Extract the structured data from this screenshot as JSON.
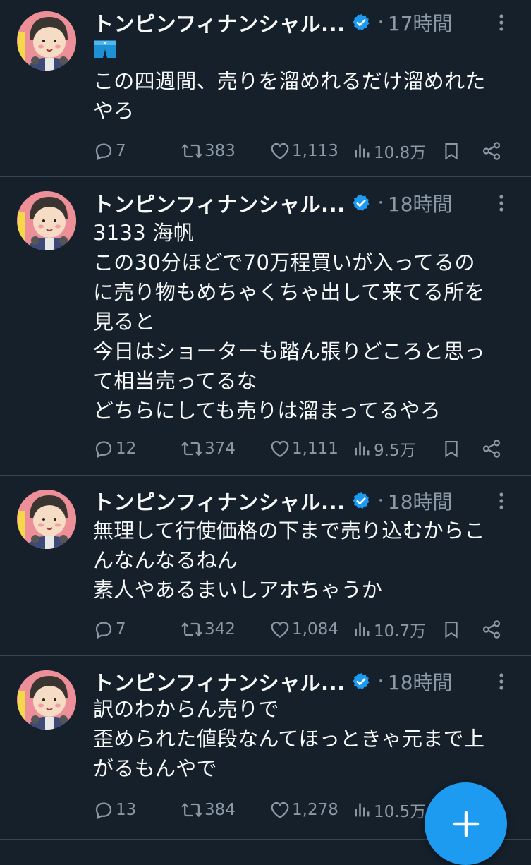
{
  "tweets": [
    {
      "name": "トンピンフィナンシャル...",
      "time": "17時間",
      "emoji": "🩳",
      "lines": [
        "この四週間、売りを溜めれるだけ溜めれた",
        "やろ"
      ],
      "replies": "7",
      "retweets": "383",
      "likes": "1,113",
      "views": "10.8万"
    },
    {
      "name": "トンピンフィナンシャル...",
      "time": "18時間",
      "lines": [
        "3133 海帆",
        "この30分ほどで70万程買いが入ってるの",
        "に売り物もめちゃくちゃ出して来てる所を",
        "見ると",
        "今日はショーターも踏ん張りどころと思っ",
        "て相当売ってるな",
        "どちらにしても売りは溜まってるやろ"
      ],
      "replies": "12",
      "retweets": "374",
      "likes": "1,111",
      "views": "9.5万"
    },
    {
      "name": "トンピンフィナンシャル...",
      "time": "18時間",
      "lines": [
        "無理して行使価格の下まで売り込むからこ",
        "んなんなるねん",
        "素人やあるまいしアホちゃうか"
      ],
      "replies": "7",
      "retweets": "342",
      "likes": "1,084",
      "views": "10.7万"
    },
    {
      "name": "トンピンフィナンシャル...",
      "time": "18時間",
      "lines": [
        "訳のわからん売りで",
        "歪められた値段なんてほっときゃ元まで上",
        "がるもんやで"
      ],
      "replies": "13",
      "retweets": "384",
      "likes": "1,278",
      "views": "10.5万"
    }
  ],
  "separator": "·",
  "colors": {
    "background": "#15202b",
    "text": "#f7f9f9",
    "muted": "#8b98a5",
    "accent": "#1d9bf0",
    "divider": "#38444d"
  },
  "icons": {
    "reply": "reply-icon",
    "retweet": "retweet-icon",
    "like": "heart-icon",
    "views": "views-icon",
    "bookmark": "bookmark-icon",
    "share": "share-icon",
    "verified": "verified-badge-icon",
    "more": "more-icon",
    "compose": "plus-icon"
  }
}
